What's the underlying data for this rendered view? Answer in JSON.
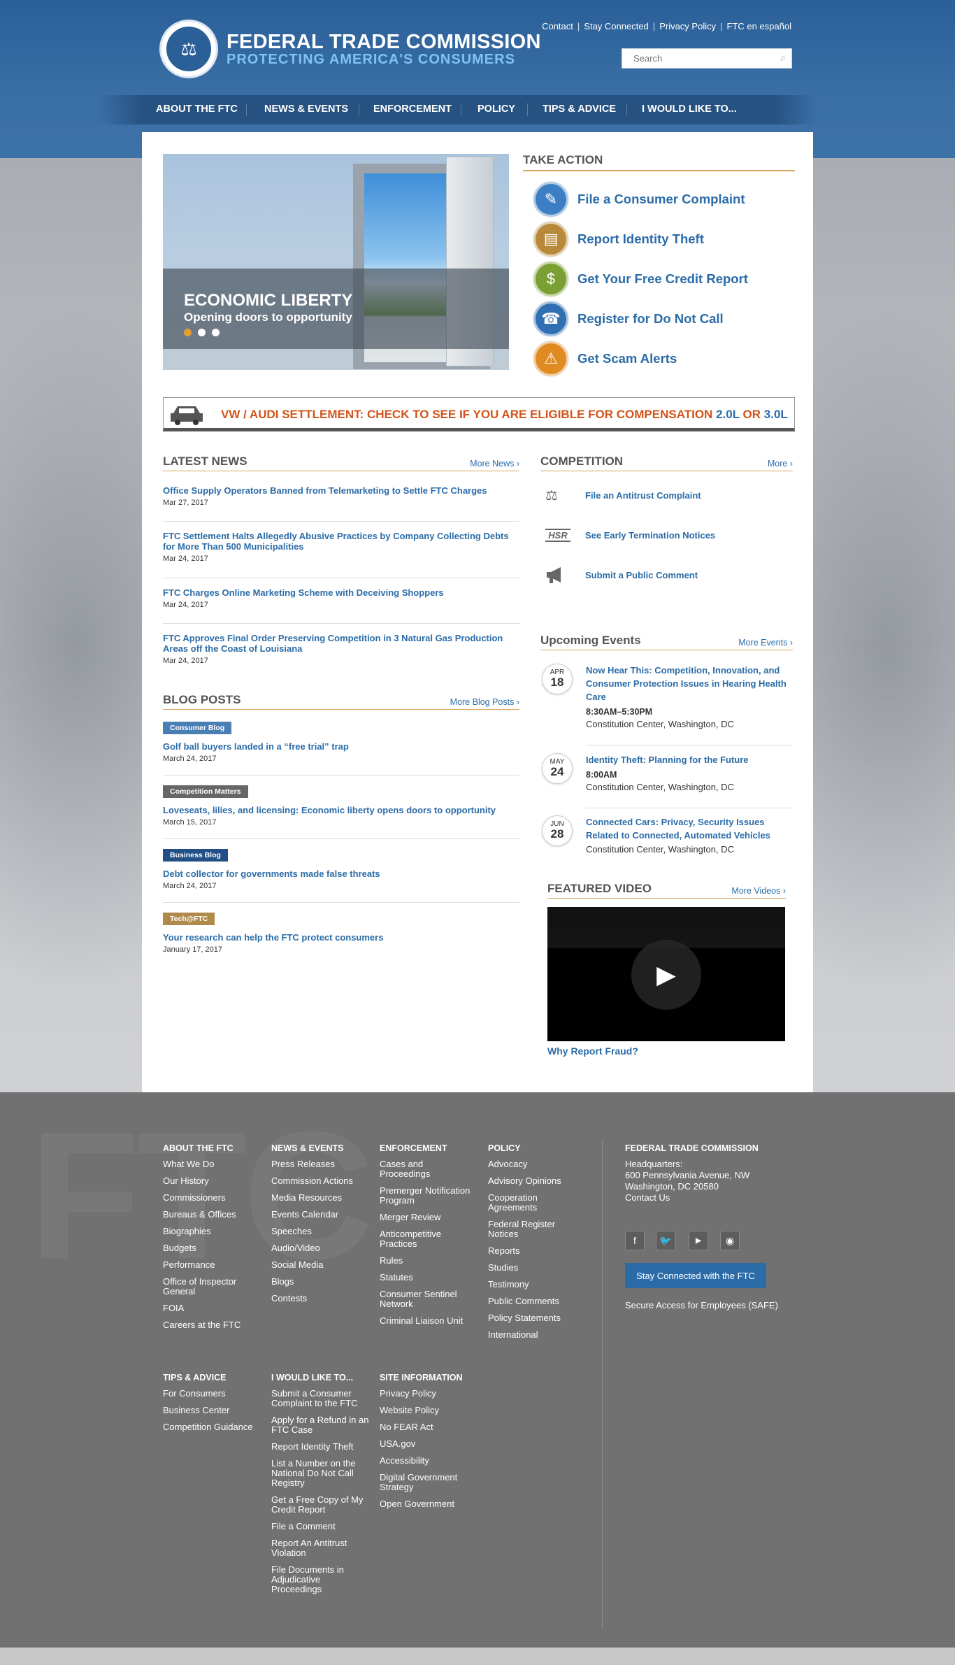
{
  "brand": {
    "title": "FEDERAL TRADE COMMISSION",
    "subtitle": "PROTECTING AMERICA'S CONSUMERS"
  },
  "utility_links": [
    "Contact",
    "Stay Connected",
    "Privacy Policy",
    "FTC en español"
  ],
  "search": {
    "placeholder": "Search"
  },
  "nav": [
    "ABOUT THE FTC",
    "NEWS & EVENTS",
    "ENFORCEMENT",
    "POLICY",
    "TIPS & ADVICE",
    "I WOULD LIKE TO..."
  ],
  "slider": {
    "title": "ECONOMIC LIBERTY",
    "subtitle": "Opening doors to opportunity",
    "slide_count": 3,
    "active_slide": 1
  },
  "take_action": {
    "header": "TAKE ACTION",
    "items": [
      {
        "label": "File a Consumer Complaint",
        "icon": "complaint-icon",
        "color": "#3d7fc4"
      },
      {
        "label": "Report Identity Theft",
        "icon": "id-card-icon",
        "color": "#b9893a"
      },
      {
        "label": "Get Your Free Credit Report",
        "icon": "coin-icon",
        "color": "#7a9f32"
      },
      {
        "label": "Register for Do Not Call",
        "icon": "phone-icon",
        "color": "#2f6fb2"
      },
      {
        "label": "Get Scam Alerts",
        "icon": "warning-icon",
        "color": "#e08a22"
      }
    ]
  },
  "banner": {
    "text": "VW / AUDI SETTLEMENT: CHECK TO SEE IF YOU ARE ELIGIBLE FOR COMPENSATION",
    "v1": "2.0L",
    "or": "OR",
    "v2": "3.0L"
  },
  "latest_news": {
    "header": "LATEST NEWS",
    "more": "More News ›",
    "items": [
      {
        "title": "Office Supply Operators Banned from Telemarketing to Settle FTC Charges",
        "date": "Mar 27, 2017"
      },
      {
        "title": "FTC Settlement Halts Allegedly Abusive Practices by Company Collecting Debts for More Than 500 Municipalities",
        "date": "Mar 24, 2017"
      },
      {
        "title": "FTC Charges Online Marketing Scheme with Deceiving Shoppers",
        "date": "Mar 24, 2017"
      },
      {
        "title": "FTC Approves Final Order Preserving Competition in 3 Natural Gas Production Areas off the Coast of Louisiana",
        "date": "Mar 24, 2017"
      }
    ]
  },
  "competition": {
    "header": "COMPETITION",
    "more": "More ›",
    "items": [
      {
        "label": "File an Antitrust Complaint",
        "icon": "scales-icon"
      },
      {
        "label": "See Early Termination Notices",
        "icon": "hsr-icon",
        "icon_text": "HSR"
      },
      {
        "label": "Submit a Public Comment",
        "icon": "megaphone-icon"
      }
    ]
  },
  "events": {
    "header": "Upcoming Events",
    "more": "More Events ›",
    "items": [
      {
        "month": "APR",
        "day": "18",
        "title": "Now Hear This: Competition, Innovation, and Consumer Protection Issues in Hearing Health Care",
        "time": "8:30AM–5:30PM",
        "location": "Constitution Center, Washington, DC"
      },
      {
        "month": "MAY",
        "day": "24",
        "title": "Identity Theft: Planning for the Future",
        "time": "8:00AM",
        "location": "Constitution Center, Washington, DC"
      },
      {
        "month": "JUN",
        "day": "28",
        "title": "Connected Cars: Privacy, Security Issues Related to Connected, Automated Vehicles",
        "time": "",
        "location": "Constitution Center, Washington, DC"
      }
    ]
  },
  "blog": {
    "header": "BLOG POSTS",
    "more": "More Blog Posts ›",
    "items": [
      {
        "tag": "Consumer Blog",
        "tag_color": "#4a7fb5",
        "title": "Golf ball buyers landed in a “free trial” trap",
        "date": "March 24, 2017"
      },
      {
        "tag": "Competition Matters",
        "tag_color": "#666666",
        "title": "Loveseats, lilies, and licensing: Economic liberty opens doors to opportunity",
        "date": "March 15, 2017"
      },
      {
        "tag": "Business Blog",
        "tag_color": "#224f86",
        "title": "Debt collector for governments made false threats",
        "date": "March 24, 2017"
      },
      {
        "tag": "Tech@FTC",
        "tag_color": "#b08a4a",
        "title": "Your research can help the FTC protect consumers",
        "date": "January 17, 2017"
      }
    ]
  },
  "video": {
    "header": "FEATURED VIDEO",
    "more": "More Videos ›",
    "caption": "Why Report Fraud?"
  },
  "footer": {
    "watermark": "FTC",
    "columns": [
      {
        "header": "ABOUT THE FTC",
        "links": [
          "What We Do",
          "Our History",
          "Commissioners",
          "Bureaus & Offices",
          "Biographies",
          "Budgets",
          "Performance",
          "Office of Inspector General",
          "FOIA",
          "Careers at the FTC"
        ]
      },
      {
        "header": "NEWS & EVENTS",
        "links": [
          "Press Releases",
          "Commission Actions",
          "Media Resources",
          "Events Calendar",
          "Speeches",
          "Audio/Video",
          "Social Media",
          "Blogs",
          "Contests"
        ]
      },
      {
        "header": "ENFORCEMENT",
        "links": [
          "Cases and Proceedings",
          "Premerger Notification Program",
          "Merger Review",
          "Anticompetitive Practices",
          "Rules",
          "Statutes",
          "Consumer Sentinel Network",
          "Criminal Liaison Unit"
        ]
      },
      {
        "header": "POLICY",
        "links": [
          "Advocacy",
          "Advisory Opinions",
          "Cooperation Agreements",
          "Federal Register Notices",
          "Reports",
          "Studies",
          "Testimony",
          "Public Comments",
          "Policy Statements",
          "International"
        ]
      },
      {
        "header": "TIPS & ADVICE",
        "links": [
          "For Consumers",
          "Business Center",
          "Competition Guidance"
        ]
      },
      {
        "header": "I WOULD LIKE TO...",
        "links": [
          "Submit a Consumer Complaint to the FTC",
          "Apply for a Refund in an FTC Case",
          "Report Identity Theft",
          "List a Number on the National Do Not Call Registry",
          "Get a Free Copy of My Credit Report",
          "File a Comment",
          "Report An Antitrust Violation",
          "File Documents in Adjudicative Proceedings"
        ]
      },
      {
        "header": "SITE INFORMATION",
        "links": [
          "Privacy Policy",
          "Website Policy",
          "No FEAR Act",
          "USA.gov",
          "Accessibility",
          "Digital Government Strategy",
          "Open Government"
        ]
      }
    ],
    "contact": {
      "header": "FEDERAL TRADE COMMISSION",
      "hq_label": "Headquarters:",
      "address1": "600 Pennsylvania Avenue, NW",
      "address2": "Washington, DC 20580",
      "contact_link": "Contact Us",
      "social": [
        "facebook-icon",
        "twitter-icon",
        "youtube-icon",
        "rss-icon"
      ],
      "stay_connected": "Stay Connected with the FTC",
      "safe_link": "Secure Access for Employees (SAFE)"
    }
  }
}
